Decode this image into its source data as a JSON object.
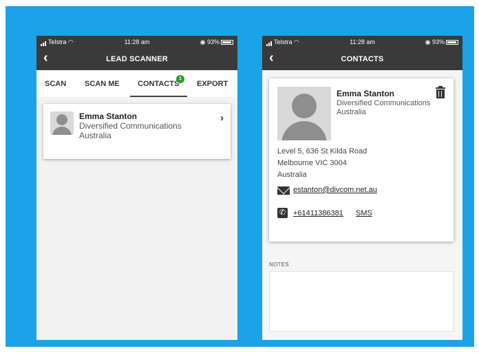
{
  "left_screen": {
    "status": {
      "carrier": "Telstra",
      "time": "11:28 am",
      "battery": "93%"
    },
    "header": {
      "back_icon": "chevron-left-icon",
      "title": "LEAD SCANNER"
    },
    "tabs": [
      {
        "label": "SCAN"
      },
      {
        "label": "SCAN ME"
      },
      {
        "label": "CONTACTS",
        "badge": "1",
        "active": true
      },
      {
        "label": "EXPORT"
      }
    ],
    "contacts": [
      {
        "name": "Emma Stanton",
        "company": "Diversified Communications Australia"
      }
    ]
  },
  "right_screen": {
    "status": {
      "carrier": "Telstra",
      "time": "11:28 am",
      "battery": "93%"
    },
    "header": {
      "back_icon": "chevron-left-icon",
      "title": "CONTACTS"
    },
    "contact": {
      "name": "Emma Stanton",
      "company": "Diversified Communications Australia",
      "address_line1": "Level 5, 636 St Kilda Road",
      "address_line2": "Melbourne VIC 3004",
      "address_line3": "Australia",
      "email": "estanton@divcom.net.au",
      "phone": "+61411386381",
      "sms_label": "SMS"
    },
    "notes_label": "NOTES",
    "notes_value": ""
  },
  "colors": {
    "background": "#1aa3e8",
    "header": "#3a3a3a",
    "badge": "#2a9d2a"
  }
}
